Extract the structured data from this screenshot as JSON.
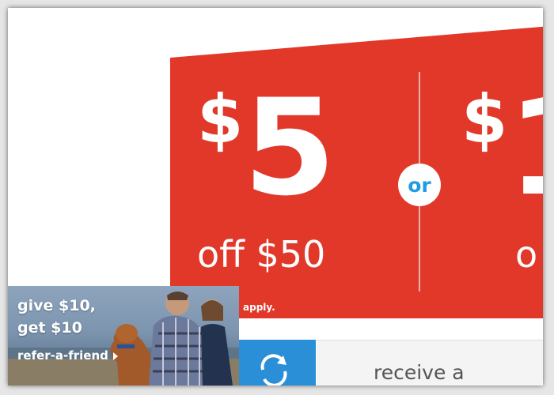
{
  "promo": {
    "offer1": {
      "currency": "$",
      "amount": "5",
      "condition": "off $50"
    },
    "connector": "or",
    "offer2": {
      "currency": "$",
      "amount": "1",
      "condition": "o"
    },
    "fine_print": "apply.",
    "colors": {
      "background": "#e1382a",
      "text": "#ffffff",
      "connector": "#1e9ee0"
    }
  },
  "refer_banner": {
    "line1": "give $10,",
    "line2": "get $10",
    "link": "refer-a-friend"
  },
  "blue_tile": {
    "icon": "refresh-icon",
    "color": "#2a8fd6"
  },
  "receive_card": {
    "text": "receive a"
  }
}
